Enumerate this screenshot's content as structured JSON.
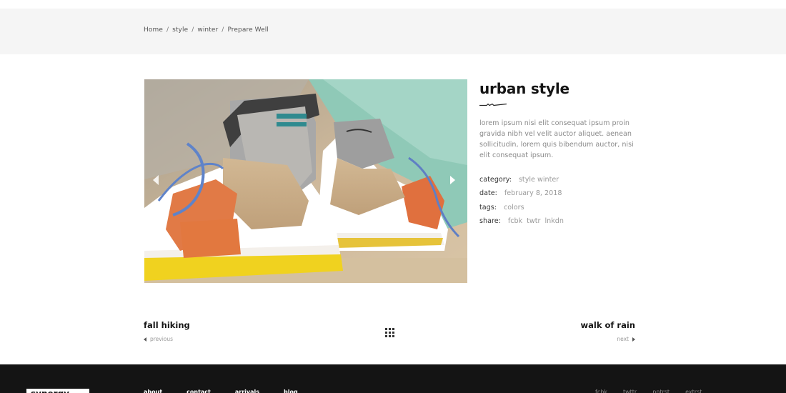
{
  "breadcrumb": {
    "items": [
      "Home",
      "style",
      "winter",
      "Prepare Well"
    ],
    "separator": "/"
  },
  "gallery": {
    "image_alt": "urban style",
    "prev_icon": "chevron-left-icon",
    "next_icon": "chevron-right-icon"
  },
  "product": {
    "title": "urban style",
    "description": "lorem ipsum nisi elit consequat ipsum proin gravida nibh vel velit auctor aliquet. aenean sollicitudin, lorem quis bibendum auctor, nisi elit consequat ipsum.",
    "meta": {
      "category_label": "category:",
      "category_value": "style winter",
      "date_label": "date:",
      "date_value": "february 8, 2018",
      "tags_label": "tags:",
      "tags_value": "colors",
      "share_label": "share:",
      "share_links": [
        "fcbk",
        "twtr",
        "lnkdn"
      ]
    }
  },
  "post_nav": {
    "prev_title": "fall hiking",
    "prev_label": "previous",
    "next_title": "walk of rain",
    "next_label": "next",
    "grid_icon": "grid-icon"
  },
  "footer": {
    "logo": "synergy",
    "nav": [
      "about",
      "contact",
      "arrivals",
      "blog"
    ],
    "social": [
      "fcbk",
      "twttr",
      "pntrst",
      "extrst"
    ]
  },
  "colors": {
    "breadcrumb_bg": "#f5f5f5",
    "footer_bg": "#141414",
    "title": "#151515",
    "muted": "#999999"
  }
}
